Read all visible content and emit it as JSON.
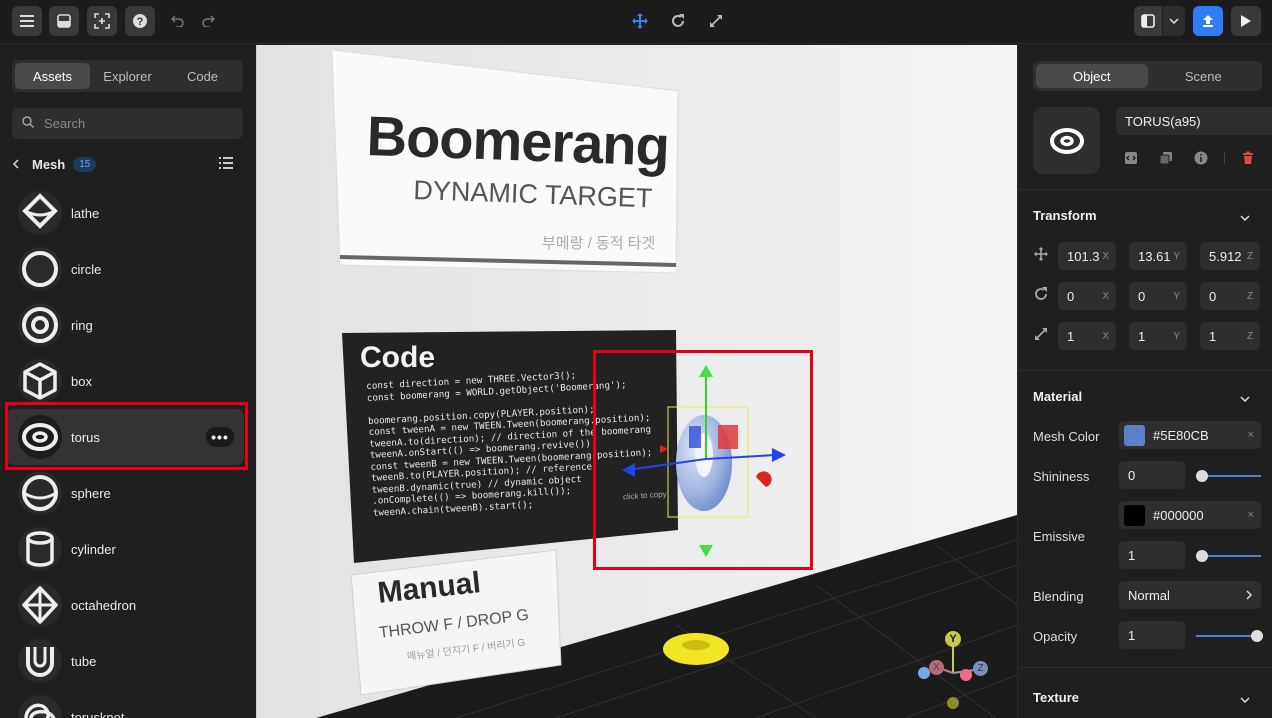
{
  "toolbar": {
    "left_icons": [
      "menu-icon",
      "inbox-icon",
      "select-region-icon",
      "help-icon",
      "undo-icon",
      "redo-icon"
    ],
    "center_icons": [
      "move-icon",
      "rotate-icon",
      "scale-icon"
    ],
    "right_icons": [
      "panel-icon",
      "chevron-down-icon",
      "upload-icon",
      "play-icon"
    ]
  },
  "left_panel": {
    "tabs": [
      {
        "label": "Assets"
      },
      {
        "label": "Explorer"
      },
      {
        "label": "Code"
      }
    ],
    "search_placeholder": "Search",
    "mesh": {
      "title": "Mesh",
      "count": "15"
    },
    "items": [
      {
        "label": "lathe",
        "icon": "lathe-icon"
      },
      {
        "label": "circle",
        "icon": "circle-icon"
      },
      {
        "label": "ring",
        "icon": "ring-icon"
      },
      {
        "label": "box",
        "icon": "box-icon"
      },
      {
        "label": "torus",
        "icon": "torus-icon",
        "selected": true
      },
      {
        "label": "sphere",
        "icon": "sphere-icon"
      },
      {
        "label": "cylinder",
        "icon": "cylinder-icon"
      },
      {
        "label": "octahedron",
        "icon": "octahedron-icon"
      },
      {
        "label": "tube",
        "icon": "tube-icon"
      },
      {
        "label": "torusknot",
        "icon": "torusknot-icon"
      }
    ]
  },
  "viewport": {
    "board_title": "Boomerang",
    "board_subtitle": "DYNAMIC TARGET",
    "board_korean": "부메랑 / 동적 타겟",
    "code_title": "Code",
    "code_lines": [
      "const direction = new THREE.Vector3();",
      "const boomerang = WORLD.getObject('Boomerang');",
      "",
      "boomerang.position.copy(PLAYER.position);",
      "const tweenA = new TWEEN.Tween(boomerang.position);",
      "tweenA.to(direction); // direction of the boomerang",
      "tweenA.onStart(() => boomerang.revive());",
      "const tweenB = new TWEEN.Tween(boomerang.position);",
      "tweenB.to(PLAYER.position); // reference",
      "tweenB.dynamic(true) // dynamic object",
      ".onComplete(() => boomerang.kill());",
      "tweenA.chain(tweenB).start();"
    ],
    "code_hint": "click to copy",
    "manual_title": "Manual",
    "manual_line": "THROW F / DROP G",
    "manual_korean": "메뉴얼 / 던지기 F / 버리기 G",
    "gizmo_labels": [
      "Y",
      "X",
      "Z"
    ]
  },
  "right_panel": {
    "tabs": [
      {
        "label": "Object"
      },
      {
        "label": "Scene"
      }
    ],
    "object_name": "TORUS(a95)",
    "action_icons": [
      "code-icon",
      "duplicate-icon",
      "info-icon",
      "trash-icon"
    ],
    "transform": {
      "title": "Transform",
      "position": [
        {
          "value": "101.3",
          "axis": "X"
        },
        {
          "value": "13.61",
          "axis": "Y"
        },
        {
          "value": "5.912",
          "axis": "Z"
        }
      ],
      "rotation": [
        {
          "value": "0",
          "axis": "X"
        },
        {
          "value": "0",
          "axis": "Y"
        },
        {
          "value": "0",
          "axis": "Z"
        }
      ],
      "scale": [
        {
          "value": "1",
          "axis": "X"
        },
        {
          "value": "1",
          "axis": "Y"
        },
        {
          "value": "1",
          "axis": "Z"
        }
      ]
    },
    "material": {
      "title": "Material",
      "mesh_color_label": "Mesh Color",
      "mesh_color": "#5E80CB",
      "shininess_label": "Shininess",
      "shininess": "0",
      "emissive_label": "Emissive",
      "emissive": "#000000",
      "emissive_intensity": "1",
      "blending_label": "Blending",
      "blending": "Normal",
      "opacity_label": "Opacity",
      "opacity": "1"
    },
    "texture_title": "Texture"
  },
  "colors": {
    "accent": "#2f7cf6",
    "selection": "#e4001b",
    "torus": "#5E80CB"
  }
}
